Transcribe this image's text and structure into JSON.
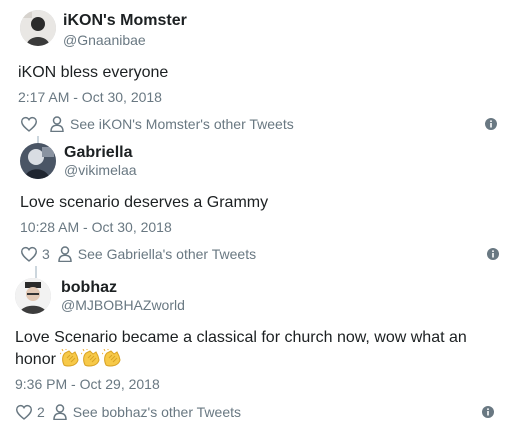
{
  "tweets": [
    {
      "display_name": "iKON's Momster",
      "handle": "@Gnaanibae",
      "text": "iKON bless everyone",
      "timestamp": "2:17 AM - Oct 30, 2018",
      "like_count": "",
      "other_tweets_label": "See iKON's Momster's other Tweets"
    },
    {
      "display_name": "Gabriella",
      "handle": "@vikimelaa",
      "text": "Love scenario deserves a Grammy",
      "timestamp": "10:28 AM - Oct 30, 2018",
      "like_count": "3",
      "other_tweets_label": "See Gabriella's other Tweets"
    },
    {
      "display_name": "bobhaz",
      "handle": "@MJBOBHAZworld",
      "text_line1": "Love Scenario became a classical for church now, wow what an",
      "text_line2": "honor",
      "emoji": [
        "clapping-hands",
        "clapping-hands",
        "clapping-hands"
      ],
      "timestamp": "9:36 PM - Oct 29, 2018",
      "like_count": "2",
      "other_tweets_label": "See bobhaz's other Tweets"
    }
  ],
  "colors": {
    "text": "#1c2022",
    "muted": "#697882",
    "thread_line": "#ccd6dd",
    "clap_yellow": "#f7c948"
  },
  "icons": [
    "heart-icon",
    "person-icon",
    "info-icon",
    "clapping-hands-emoji"
  ]
}
